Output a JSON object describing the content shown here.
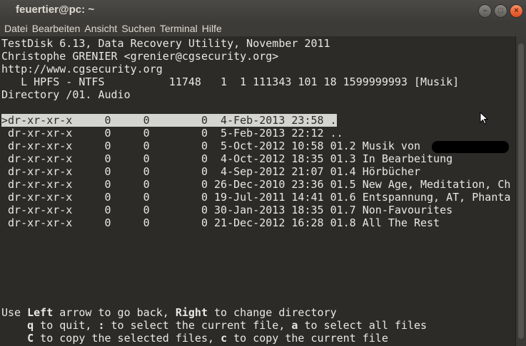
{
  "window": {
    "title": "feuertier@pc: ~"
  },
  "menubar": {
    "items": [
      "Datei",
      "Bearbeiten",
      "Ansicht",
      "Suchen",
      "Terminal",
      "Hilfe"
    ]
  },
  "terminal": {
    "header": [
      "TestDisk 6.13, Data Recovery Utility, November 2011",
      "Christophe GRENIER <grenier@cgsecurity.org>",
      "http://www.cgsecurity.org",
      "   L HPFS - NTFS          11748   1  1 111343 101 18 1599999993 [Musik]",
      "Directory /01. Audio"
    ],
    "rows": [
      ">dr-xr-xr-x     0     0        0  4-Feb-2013 23:58 .",
      " dr-xr-xr-x     0     0        0  5-Feb-2013 22:12 ..",
      " dr-xr-xr-x     0     0        0  5-Oct-2012 10:58 01.2 Musik von",
      " dr-xr-xr-x     0     0        0  4-Oct-2012 18:35 01.3 In Bearbeitung",
      " dr-xr-xr-x     0     0        0  4-Sep-2012 21:07 01.4 Hörbücher",
      " dr-xr-xr-x     0     0        0 26-Dec-2010 23:36 01.5 New Age, Meditation, Ch",
      " dr-xr-xr-x     0     0        0 19-Jul-2011 14:41 01.6 Entspannung, AT, Phanta",
      " dr-xr-xr-x     0     0        0 30-Jan-2013 18:35 01.7 Non-Favourites",
      " dr-xr-xr-x     0     0        0 21-Dec-2012 16:28 01.8 All The Rest"
    ],
    "help": {
      "l1": {
        "use": "Use ",
        "left": "Left",
        "goback": " arrow to go back, ",
        "right": "Right",
        "change": " to change directory"
      },
      "l2": {
        "pad": "    ",
        "q": "q",
        "quit": " to quit, ",
        "colon": ":",
        "select": " to select the current file, ",
        "a": "a",
        "selall": " to select all files"
      },
      "l3": {
        "pad": "    ",
        "C": "C",
        "copysel": " to copy the selected files, ",
        "c": "c",
        "copycur": " to copy the current file"
      }
    }
  }
}
